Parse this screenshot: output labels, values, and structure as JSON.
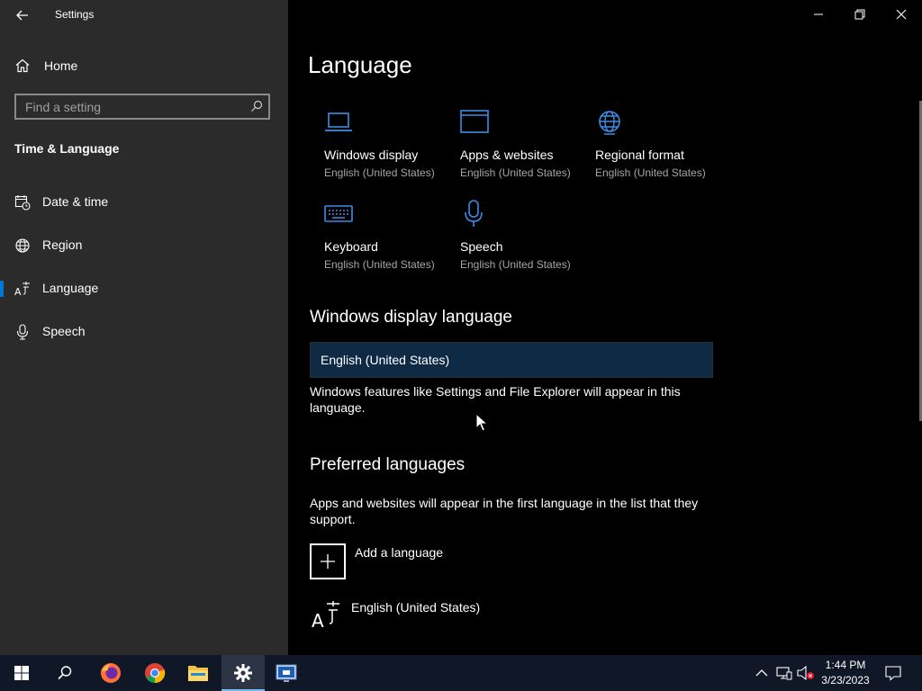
{
  "window": {
    "title": "Settings"
  },
  "sidebar": {
    "home_label": "Home",
    "search_placeholder": "Find a setting",
    "section_title": "Time & Language",
    "items": [
      {
        "label": "Date & time",
        "icon": "calendar-clock-icon",
        "selected": false
      },
      {
        "label": "Region",
        "icon": "globe-icon",
        "selected": false
      },
      {
        "label": "Language",
        "icon": "language-icon",
        "selected": true
      },
      {
        "label": "Speech",
        "icon": "microphone-icon",
        "selected": false
      }
    ]
  },
  "main": {
    "page_title": "Language",
    "tiles": [
      {
        "name": "Windows display",
        "sub": "English (United States)",
        "icon": "laptop-icon"
      },
      {
        "name": "Apps & websites",
        "sub": "English (United States)",
        "icon": "browser-window-icon"
      },
      {
        "name": "Regional format",
        "sub": "English (United States)",
        "icon": "globe-icon"
      },
      {
        "name": "Keyboard",
        "sub": "English (United States)",
        "icon": "keyboard-icon"
      },
      {
        "name": "Speech",
        "sub": "English (United States)",
        "icon": "microphone-icon"
      }
    ],
    "display_language": {
      "heading": "Windows display language",
      "selected_value": "English (United States)",
      "description": "Windows features like Settings and File Explorer will appear in this language."
    },
    "preferred": {
      "heading": "Preferred languages",
      "description": "Apps and websites will appear in the first language in the list that they support.",
      "add_label": "Add a language",
      "languages": [
        "English (United States)"
      ]
    }
  },
  "taskbar": {
    "apps": [
      "start-icon",
      "search-icon",
      "firefox-icon",
      "chrome-icon",
      "file-explorer-icon",
      "settings-icon",
      "remote-app-icon"
    ],
    "active_app": "settings-icon",
    "time": "1:44 PM",
    "date": "3/23/2023"
  },
  "colors": {
    "accent": "#0078d7",
    "sidebar_bg": "#2b2b2b",
    "select_bg": "#0e2a45",
    "taskbar_bg": "#101727"
  }
}
